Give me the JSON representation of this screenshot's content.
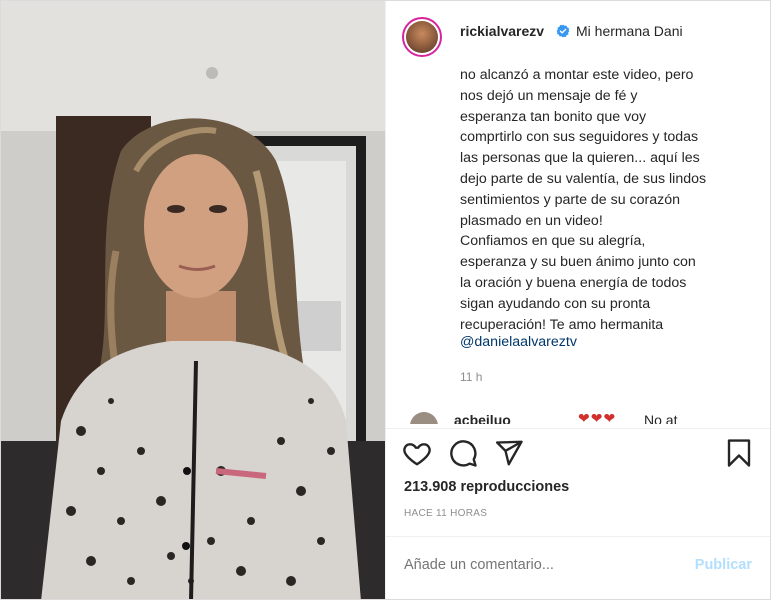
{
  "post": {
    "username": "rickialvarezv",
    "caption_first_line": "Mi hermana Dani",
    "caption_body": "no alcanzó a montar este video, pero\nnos dejó un mensaje de fé y\nesperanza tan bonito que voy\ncomprtirlo con sus seguidores y todas\nlas personas que la quieren... aquí les\ndejo parte de su valentía, de sus lindos\nsentimientos y parte de su corazón\nplasmado en un video!\nConfiamos en que su alegría,\nesperanza y su buen ánimo junto con\nla oración y buena energía de todos\nsigan ayudando con su pronta\nrecuperación! Te amo hermanita",
    "mention": "@danielaalvareztv",
    "relative_time": "11 h"
  },
  "comment_preview": {
    "username": "acbeiluo",
    "hearts": "❤❤❤",
    "text_fragment": "No at"
  },
  "stats": {
    "views": "213.908 reproducciones",
    "timestamp": "HACE 11 HORAS"
  },
  "comment_input": {
    "placeholder": "Añade un comentario...",
    "post_label": "Publicar"
  },
  "icons": {
    "verified": "verified-badge-icon",
    "like": "heart-icon",
    "comment": "comment-bubble-icon",
    "share": "paper-plane-icon",
    "save": "bookmark-icon"
  },
  "colors": {
    "accent_blue": "#0095f6",
    "mention": "#00376b",
    "post_disabled": "#b2dffc",
    "text": "#262626",
    "muted": "#8e8e8e"
  }
}
